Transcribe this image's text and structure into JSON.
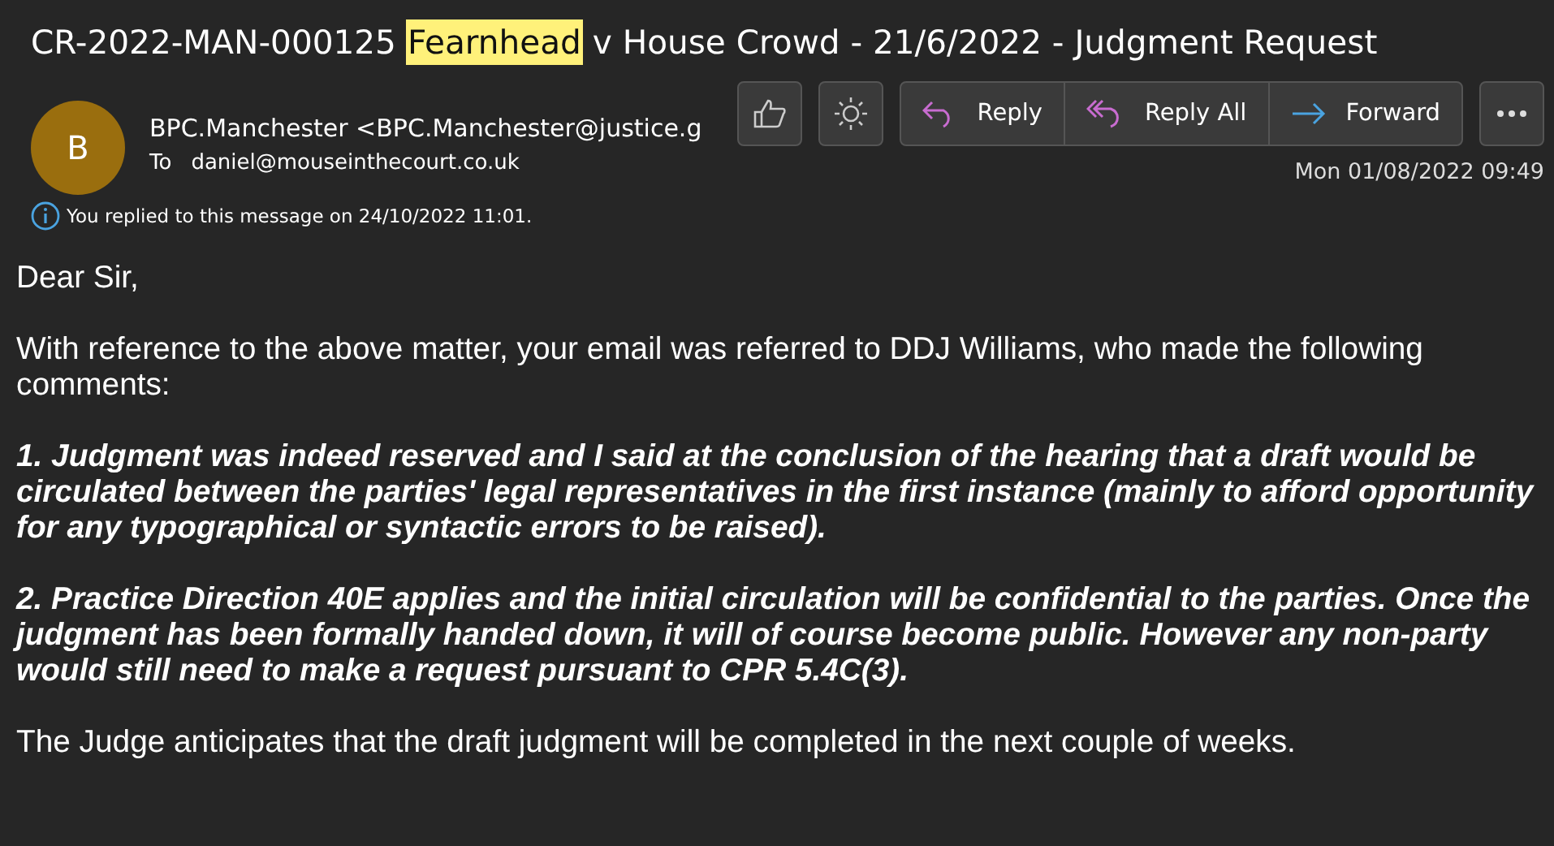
{
  "subject": [
    {
      "text": "CR-2022-MAN-000125",
      "highlighted": false
    },
    {
      "text": "Fearnhead",
      "highlighted": true
    },
    {
      "text": "v House Crowd - 21/6/2022 - Judgment Request",
      "highlighted": false
    }
  ],
  "sender": {
    "initial": "B",
    "from": "BPC.Manchester <BPC.Manchester@justice.g",
    "to_label": "To",
    "to": "daniel@mouseinthecourt.co.uk",
    "date": "Mon 01/08/2022 09:49"
  },
  "info": "You replied to this message on 24/10/2022 11:01.",
  "actions": [
    {
      "kind": "reply",
      "label": "Reply"
    },
    {
      "kind": "reply_all",
      "label": "Reply All"
    },
    {
      "kind": "forward",
      "label": "Forward"
    }
  ],
  "body": [
    {
      "kind": "plain",
      "text": "Dear Sir,"
    },
    {
      "kind": "plain",
      "text": "With reference to the above matter, your email was referred to DDJ Williams, who made the following comments:"
    },
    {
      "kind": "emphasis",
      "text": "1. Judgment was indeed reserved and I said at the conclusion of the hearing that a draft would be circulated between the parties' legal representatives in the first instance (mainly to afford opportunity for any typographical or syntactic errors to be raised)."
    },
    {
      "kind": "emphasis",
      "text": "2. Practice Direction 40E applies and the initial circulation will be confidential to the parties. Once the judgment has been formally handed down, it will of course become public. However any non-party would still need to make a request pursuant to CPR 5.4C(3)."
    },
    {
      "kind": "plain",
      "text": "The Judge anticipates that the draft judgment will be completed in the next couple of weeks."
    }
  ]
}
